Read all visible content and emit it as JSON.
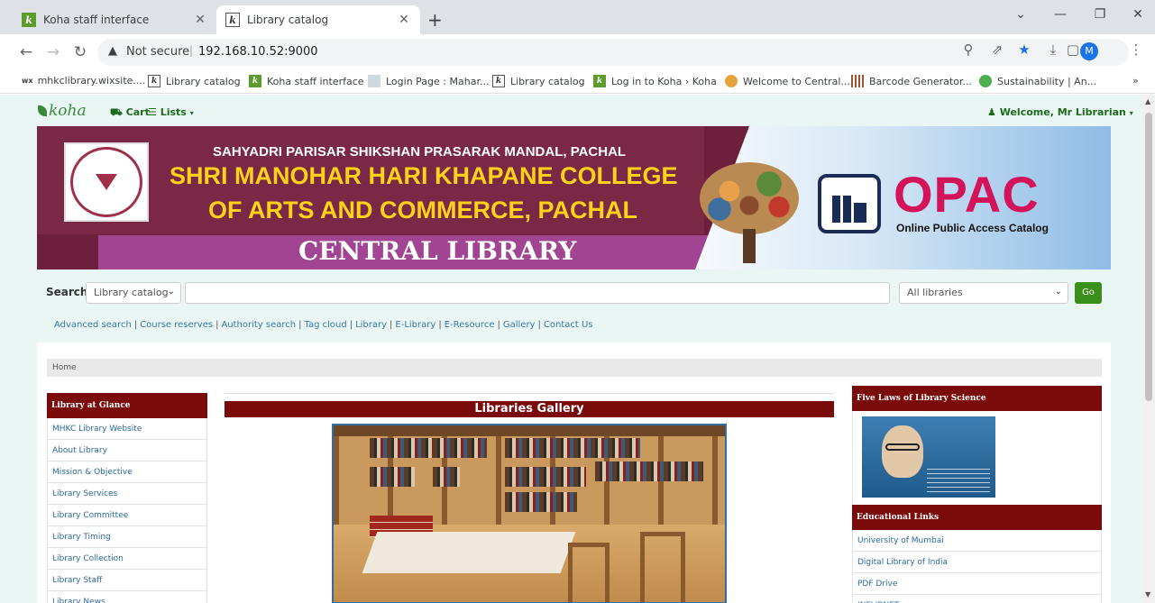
{
  "browser": {
    "tabs": [
      {
        "title": "Koha staff interface",
        "active": false
      },
      {
        "title": "Library catalog",
        "active": true
      }
    ],
    "address": {
      "security": "Not secure",
      "url": "192.168.10.52:9000"
    },
    "profile_initial": "M",
    "bookmarks": [
      "mhkclibrary.wixsite....",
      "Library catalog",
      "Koha staff interface",
      "Login Page : Mahar...",
      "Library catalog",
      "Log in to Koha › Koha",
      "Welcome to Central...",
      "Barcode Generator...",
      "Sustainability | An..."
    ],
    "wix_badge": "wx"
  },
  "koha": {
    "logo": "koha",
    "cart": "Cart",
    "lists": "Lists",
    "welcome": "Welcome, Mr Librarian"
  },
  "banner": {
    "line1": "SAHYADRI PARISAR SHIKSHAN PRASARAK MANDAL, PACHAL",
    "line2": "SHRI MANOHAR HARI KHAPANE COLLEGE",
    "line3": "OF ARTS AND COMMERCE, PACHAL",
    "line4": "CENTRAL LIBRARY",
    "opac": "OPAC",
    "opac_sub": "Online Public Access Catalog"
  },
  "search": {
    "label": "Search",
    "scope": "Library catalog",
    "query": "",
    "library": "All libraries",
    "go": "Go"
  },
  "links": [
    "Advanced search",
    "Course reserves",
    "Authority search",
    "Tag cloud",
    "Library",
    "E-Library",
    "E-Resource",
    "Gallery",
    "Contact Us"
  ],
  "breadcrumb": "Home",
  "left_nav": {
    "heading": "Library at Glance",
    "items": [
      "MHKC Library Website",
      "About Library",
      "Mission & Objective",
      "Library Services",
      "Library Committee",
      "Library Timing",
      "Library Collection",
      "Library Staff",
      "Library News"
    ]
  },
  "gallery": {
    "title": "Libraries Gallery"
  },
  "right_col": {
    "laws_heading": "Five Laws of Library Science",
    "edu_heading": "Educational Links",
    "edu_items": [
      "University of Mumbai",
      "Digital Library of India",
      "PDF Drive",
      "INFLIBNET"
    ]
  }
}
